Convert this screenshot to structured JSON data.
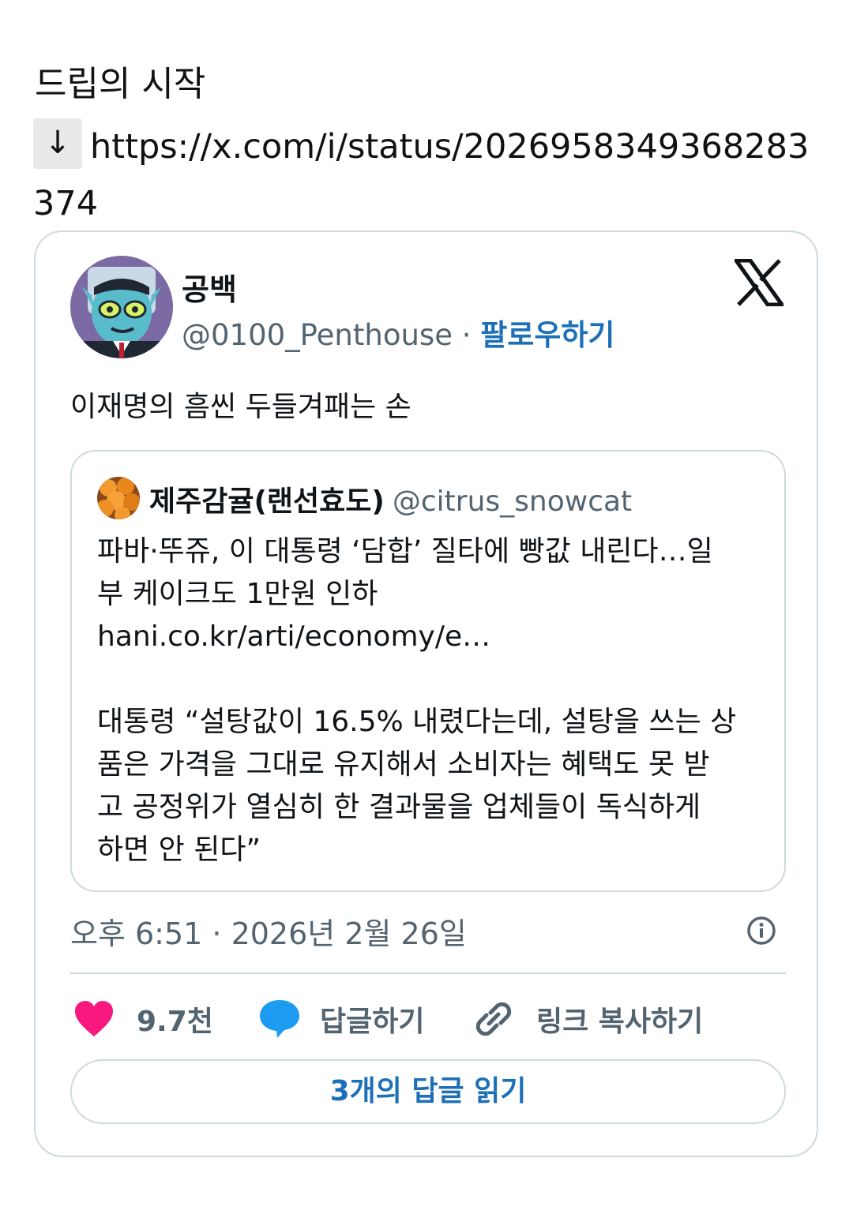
{
  "post": {
    "title": "드립의 시작",
    "arrow": "↓",
    "link": "https://x.com/i/status/2026958349368283374"
  },
  "tweet": {
    "author_name": "공백",
    "author_handle": "@0100_Penthouse",
    "separator": "·",
    "follow_label": "팔로우하기",
    "text": "이재명의 흠씬 두들겨패는 손",
    "quote": {
      "author_name": "제주감귤(랜선효도)",
      "author_handle": "@citrus_snowcat",
      "line1": "파바·뚜쥬, 이 대통령 ‘담합’ 질타에 빵값 내린다…일",
      "line2": "부 케이크도 1만원 인하",
      "line3": "hani.co.kr/arti/economy/e…",
      "line4": "대통령 “설탕값이 16.5% 내렸다는데, 설탕을 쓰는 상",
      "line5": "품은 가격을 그대로 유지해서 소비자는 혜택도 못 받",
      "line6": "고 공정위가 열심히 한 결과물을 업체들이 독식하게",
      "line7": "하면 안 된다”"
    },
    "timestamp": "오후 6:51 · 2026년 2월 26일",
    "like_count": "9.7천",
    "reply_label": "답글하기",
    "copy_link_label": "링크 복사하기",
    "read_replies_label": "3개의 답글 읽기"
  },
  "colors": {
    "like": "#f91880",
    "reply": "#1d9bf0",
    "link": "#1d70b8",
    "muted": "#536471",
    "border": "#cfd9de"
  },
  "icons": [
    "x-logo-icon",
    "info-icon",
    "heart-icon",
    "speech-bubble-icon",
    "link-icon"
  ]
}
